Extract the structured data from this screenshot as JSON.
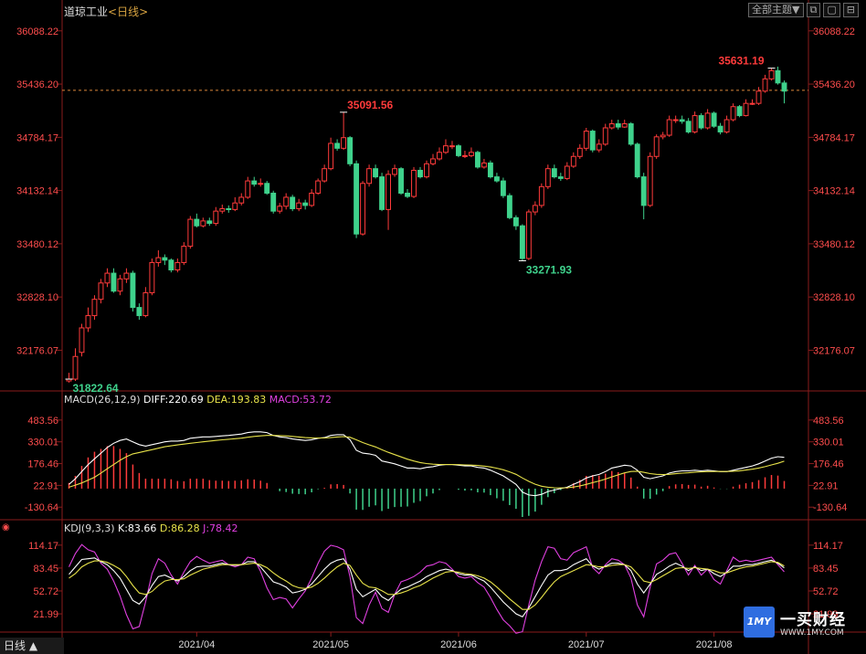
{
  "header": {
    "index_name": "道琼工业",
    "period": "<日线>",
    "theme_button": "全部主题▼"
  },
  "bottom_tab": {
    "label": "日线 ▲"
  },
  "watermark": {
    "name": "一买财经",
    "url": "WWW.1MY.COM",
    "logo_text": "1MY"
  },
  "colors": {
    "up": "#ff3b3b",
    "down": "#3fd28c",
    "diff": "#ffffff",
    "dea": "#e8e34a",
    "macd": "#e040e0",
    "grid": "#8a1c1c",
    "axis_text": "#ff4d4d"
  },
  "chart_data": [
    {
      "type": "candlestick",
      "name": "price",
      "y_ticks": [
        "36088.22",
        "35436.20",
        "34784.17",
        "34132.14",
        "33480.12",
        "32828.10",
        "32176.07"
      ],
      "ylim": [
        31700,
        36220
      ],
      "current_price_line": 35360,
      "x_ticks": [
        "2021/04",
        "2021/05",
        "2021/06",
        "2021/07",
        "2021/08"
      ],
      "x_tick_index": [
        20,
        41,
        61,
        81,
        101
      ],
      "annotations": [
        {
          "label": "35091.56",
          "index": 43,
          "value": 35091.56,
          "color": "up"
        },
        {
          "label": "33271.93",
          "index": 71,
          "value": 33271.93,
          "color": "down"
        },
        {
          "label": "35631.19",
          "index": 110,
          "value": 35631.19,
          "color": "up"
        },
        {
          "label": "31822.64",
          "index": 0,
          "value": 31822.64,
          "color": "down"
        }
      ],
      "close": [
        31822.6,
        32100,
        32450,
        32600,
        32800,
        33000,
        33120,
        32900,
        33050,
        33120,
        32700,
        32600,
        32880,
        33250,
        33310,
        33280,
        33160,
        33250,
        33450,
        33780,
        33700,
        33760,
        33730,
        33880,
        33910,
        33900,
        33980,
        34050,
        34250,
        34210,
        34220,
        34100,
        33880,
        33940,
        34050,
        33910,
        33980,
        33950,
        34100,
        34250,
        34400,
        34710,
        34650,
        34780,
        34460,
        33600,
        34220,
        34400,
        34300,
        33900,
        34330,
        34400,
        34100,
        34060,
        34380,
        34300,
        34460,
        34520,
        34600,
        34680,
        34680,
        34560,
        34560,
        34600,
        34420,
        34470,
        34300,
        34250,
        34070,
        33800,
        33700,
        33300,
        33870,
        33950,
        34180,
        34400,
        34300,
        34280,
        34430,
        34550,
        34650,
        34860,
        34630,
        34700,
        34900,
        34950,
        34910,
        34950,
        34700,
        34300,
        33950,
        34550,
        34790,
        34810,
        35000,
        35000,
        34980,
        34850,
        35050,
        34900,
        35080,
        34920,
        34850,
        35000,
        35160,
        35050,
        35200,
        35200,
        35350,
        35500,
        35600,
        35450,
        35350
      ],
      "open": [
        31800,
        31822.6,
        32150,
        32450,
        32600,
        32800,
        33000,
        33120,
        32900,
        33050,
        33120,
        32700,
        32600,
        32880,
        33250,
        33310,
        33280,
        33160,
        33250,
        33450,
        33780,
        33700,
        33760,
        33730,
        33880,
        33910,
        33900,
        33980,
        34050,
        34250,
        34210,
        34220,
        34100,
        33880,
        33940,
        34050,
        33910,
        33980,
        33950,
        34100,
        34250,
        34400,
        34710,
        34650,
        34780,
        34460,
        33600,
        34220,
        34400,
        34300,
        33900,
        34330,
        34400,
        34100,
        34060,
        34380,
        34300,
        34460,
        34520,
        34600,
        34680,
        34680,
        34560,
        34560,
        34600,
        34420,
        34470,
        34300,
        34250,
        34070,
        33800,
        33700,
        33300,
        33870,
        33950,
        34180,
        34400,
        34300,
        34280,
        34430,
        34550,
        34650,
        34860,
        34630,
        34700,
        34900,
        34950,
        34910,
        34950,
        34700,
        34300,
        33950,
        34550,
        34790,
        34810,
        35000,
        35000,
        34980,
        34850,
        35050,
        34900,
        35080,
        34920,
        34850,
        35000,
        35160,
        35050,
        35200,
        35200,
        35350,
        35500,
        35600,
        35450
      ],
      "high": [
        31900,
        32200,
        32500,
        32700,
        32850,
        33050,
        33180,
        33180,
        33100,
        33180,
        33150,
        32750,
        32950,
        33300,
        33400,
        33350,
        33300,
        33300,
        33500,
        33820,
        33850,
        33800,
        33800,
        33930,
        33960,
        33950,
        34050,
        34100,
        34300,
        34300,
        34280,
        34250,
        34130,
        33980,
        34100,
        34080,
        34030,
        34020,
        34150,
        34280,
        34450,
        34780,
        34760,
        35091.6,
        34800,
        34500,
        34250,
        34450,
        34450,
        34350,
        34380,
        34450,
        34420,
        34150,
        34420,
        34420,
        34500,
        34580,
        34660,
        34760,
        34740,
        34700,
        34620,
        34660,
        34620,
        34520,
        34500,
        34350,
        34290,
        34100,
        33830,
        33720,
        33900,
        34000,
        34220,
        34450,
        34450,
        34350,
        34480,
        34600,
        34700,
        34900,
        34880,
        34760,
        34950,
        35000,
        35000,
        35000,
        34970,
        34720,
        34350,
        34600,
        34820,
        34850,
        35050,
        35050,
        35050,
        35020,
        35100,
        35080,
        35130,
        35100,
        34960,
        35050,
        35200,
        35180,
        35250,
        35250,
        35400,
        35550,
        35631.2,
        35650,
        35480
      ],
      "low": [
        31780,
        31800,
        32100,
        32400,
        32550,
        32750,
        32950,
        32880,
        32850,
        33000,
        32650,
        32550,
        32580,
        32850,
        33200,
        33220,
        33130,
        33130,
        33220,
        33420,
        33680,
        33680,
        33700,
        33700,
        33850,
        33860,
        33880,
        33950,
        34030,
        34180,
        34180,
        34080,
        33850,
        33850,
        33900,
        33880,
        33880,
        33900,
        33930,
        34080,
        34230,
        34380,
        34620,
        34630,
        34430,
        33550,
        33580,
        34180,
        34280,
        33880,
        33650,
        34300,
        34080,
        34040,
        34040,
        34280,
        34280,
        34440,
        34500,
        34580,
        34640,
        34540,
        34530,
        34540,
        34400,
        34400,
        34280,
        34230,
        34040,
        33780,
        33650,
        33271.9,
        33280,
        33830,
        33920,
        34150,
        34280,
        34250,
        34260,
        34410,
        34520,
        34620,
        34600,
        34600,
        34680,
        34880,
        34880,
        34900,
        34680,
        34280,
        33780,
        33930,
        34520,
        34760,
        34790,
        34960,
        34950,
        34830,
        34830,
        34880,
        34880,
        34900,
        34820,
        34830,
        34980,
        35030,
        35040,
        35180,
        35180,
        35330,
        35480,
        35430,
        35200
      ]
    },
    {
      "type": "macd",
      "name": "MACD",
      "label": "MACD(26,12,9)",
      "diff_label": "DIFF:220.69",
      "dea_label": "DEA:193.83",
      "macd_label": "MACD:53.72",
      "y_ticks": [
        "483.56",
        "330.01",
        "176.46",
        "22.91",
        "-130.64"
      ],
      "ylim": [
        -200,
        560
      ],
      "diff": [
        30,
        70,
        120,
        170,
        210,
        250,
        290,
        320,
        340,
        350,
        330,
        310,
        300,
        310,
        320,
        330,
        335,
        335,
        340,
        355,
        360,
        365,
        365,
        368,
        372,
        375,
        380,
        385,
        395,
        400,
        400,
        395,
        375,
        365,
        360,
        350,
        345,
        340,
        345,
        355,
        360,
        375,
        380,
        380,
        345,
        270,
        250,
        245,
        235,
        195,
        185,
        175,
        160,
        145,
        145,
        140,
        150,
        155,
        165,
        170,
        170,
        165,
        160,
        160,
        150,
        145,
        130,
        110,
        90,
        60,
        30,
        -25,
        -45,
        -50,
        -40,
        -20,
        -10,
        0,
        10,
        30,
        50,
        75,
        90,
        100,
        120,
        145,
        155,
        165,
        160,
        130,
        80,
        70,
        80,
        90,
        110,
        120,
        125,
        125,
        130,
        125,
        130,
        125,
        120,
        120,
        130,
        140,
        150,
        160,
        175,
        195,
        215,
        225,
        220.69
      ],
      "dea": [
        10,
        25,
        40,
        60,
        80,
        110,
        140,
        170,
        200,
        225,
        245,
        255,
        265,
        275,
        285,
        295,
        302,
        308,
        314,
        320,
        325,
        330,
        335,
        340,
        344,
        348,
        352,
        356,
        362,
        368,
        372,
        375,
        375,
        374,
        372,
        368,
        364,
        360,
        358,
        357,
        357,
        360,
        364,
        367,
        362,
        344,
        325,
        309,
        294,
        274,
        256,
        240,
        224,
        208,
        195,
        184,
        177,
        172,
        170,
        170,
        170,
        169,
        167,
        166,
        163,
        159,
        153,
        144,
        133,
        118,
        101,
        75,
        51,
        31,
        17,
        10,
        6,
        5,
        6,
        11,
        19,
        30,
        42,
        54,
        67,
        83,
        97,
        111,
        121,
        123,
        115,
        106,
        101,
        99,
        101,
        105,
        109,
        112,
        116,
        118,
        120,
        121,
        121,
        121,
        123,
        126,
        131,
        137,
        145,
        155,
        167,
        179,
        193.83
      ]
    },
    {
      "type": "kdj",
      "name": "KDJ",
      "label": "KDJ(9,3,3)",
      "k_label": "K:83.66",
      "d_label": "D:86.28",
      "j_label": "J:78.42",
      "y_ticks": [
        "114.17",
        "83.45",
        "52.72",
        "21.99"
      ],
      "ylim": [
        0,
        125
      ],
      "k": [
        75,
        85,
        95,
        96,
        97,
        92,
        88,
        80,
        70,
        55,
        40,
        35,
        45,
        60,
        72,
        74,
        70,
        66,
        72,
        80,
        85,
        86,
        86,
        88,
        90,
        88,
        87,
        88,
        92,
        92,
        85,
        75,
        65,
        62,
        58,
        50,
        52,
        55,
        62,
        72,
        82,
        90,
        94,
        96,
        82,
        55,
        45,
        50,
        55,
        45,
        40,
        48,
        55,
        58,
        62,
        66,
        72,
        76,
        80,
        82,
        80,
        76,
        74,
        74,
        70,
        66,
        58,
        48,
        38,
        30,
        22,
        18,
        30,
        45,
        60,
        74,
        80,
        80,
        82,
        88,
        92,
        96,
        86,
        82,
        86,
        90,
        90,
        88,
        80,
        62,
        50,
        62,
        75,
        80,
        86,
        90,
        86,
        80,
        85,
        80,
        82,
        76,
        72,
        78,
        86,
        86,
        88,
        88,
        90,
        92,
        94,
        90,
        83.66
      ],
      "d": [
        70,
        76,
        85,
        90,
        93,
        93,
        91,
        87,
        82,
        72,
        60,
        50,
        48,
        52,
        60,
        66,
        68,
        68,
        69,
        74,
        78,
        82,
        84,
        86,
        88,
        88,
        88,
        88,
        89,
        90,
        88,
        84,
        77,
        71,
        66,
        60,
        57,
        56,
        58,
        63,
        70,
        78,
        85,
        90,
        87,
        74,
        63,
        58,
        57,
        53,
        48,
        48,
        50,
        53,
        57,
        60,
        65,
        70,
        74,
        78,
        79,
        78,
        76,
        75,
        73,
        70,
        65,
        58,
        50,
        42,
        35,
        28,
        28,
        34,
        44,
        55,
        65,
        72,
        76,
        80,
        84,
        88,
        87,
        85,
        85,
        87,
        88,
        88,
        85,
        76,
        66,
        64,
        68,
        73,
        78,
        83,
        84,
        83,
        84,
        83,
        82,
        80,
        77,
        77,
        80,
        83,
        85,
        86,
        88,
        90,
        92,
        91,
        86.28
      ],
      "j": [
        85,
        103,
        115,
        108,
        105,
        90,
        82,
        66,
        46,
        21,
        2,
        5,
        38,
        76,
        96,
        90,
        74,
        62,
        78,
        92,
        99,
        94,
        90,
        92,
        94,
        88,
        85,
        88,
        98,
        96,
        79,
        57,
        41,
        44,
        42,
        30,
        42,
        53,
        70,
        90,
        106,
        114,
        112,
        108,
        72,
        17,
        9,
        34,
        51,
        29,
        24,
        48,
        65,
        68,
        72,
        78,
        86,
        88,
        92,
        90,
        82,
        72,
        70,
        72,
        64,
        58,
        44,
        28,
        14,
        6,
        -4,
        -2,
        34,
        67,
        92,
        112,
        110,
        96,
        94,
        104,
        108,
        112,
        84,
        76,
        88,
        96,
        94,
        88,
        70,
        34,
        18,
        58,
        89,
        94,
        102,
        104,
        90,
        74,
        87,
        74,
        82,
        68,
        62,
        80,
        98,
        92,
        94,
        92,
        94,
        96,
        98,
        88,
        78.42
      ]
    }
  ]
}
